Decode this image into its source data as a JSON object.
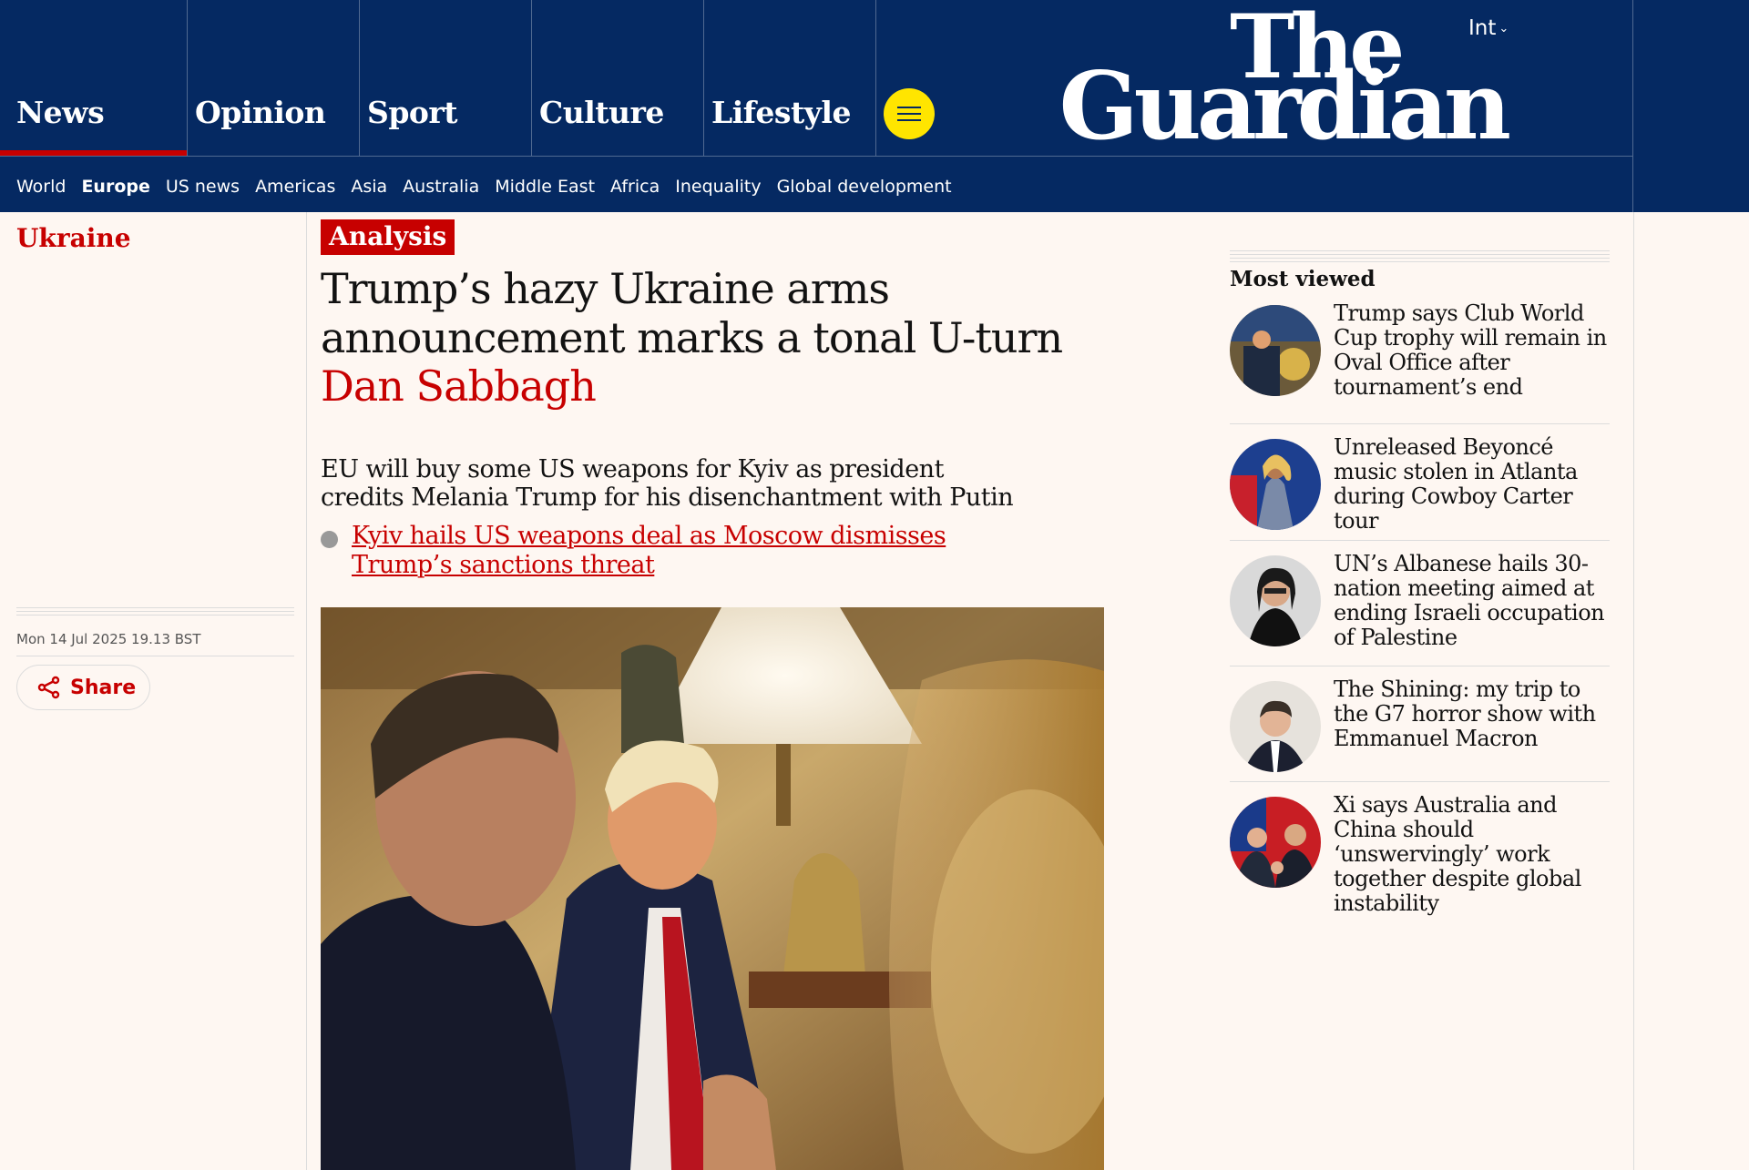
{
  "header": {
    "pillars": [
      "News",
      "Opinion",
      "Sport",
      "Culture",
      "Lifestyle"
    ],
    "edition": "Int",
    "logo_line1": "The",
    "logo_line2": "Guardian",
    "subnav": [
      "World",
      "Europe",
      "US news",
      "Americas",
      "Asia",
      "Australia",
      "Middle East",
      "Africa",
      "Inequality",
      "Global development"
    ]
  },
  "article": {
    "section": "Ukraine",
    "kicker": "Analysis",
    "headline": "Trump’s hazy Ukraine arms announcement marks a tonal U-turn",
    "byline": "Dan Sabbagh",
    "standfirst": "EU will buy some US weapons for Kyiv as president credits Melania Trump for his disenchantment with Putin",
    "related_link": "Kyiv hails US weapons deal as Moscow dismisses Trump’s sanctions threat",
    "dateline": "Mon 14 Jul 2025 19.13 BST",
    "share_label": "Share"
  },
  "most_viewed": {
    "title": "Most viewed",
    "items": [
      "Trump says Club World Cup trophy will remain in Oval Office after tournament’s end",
      "Unreleased Beyoncé music stolen in Atlanta during Cowboy Carter tour",
      "UN’s Albanese hails 30-nation meeting aimed at ending Israeli occupation of Palestine",
      "The Shining: my trip to the G7 horror show with Emmanuel Macron",
      "Xi says Australia and China should ‘unswervingly’ work together despite global instability"
    ]
  },
  "colors": {
    "brand_navy": "#052962",
    "accent_red": "#c70000",
    "menu_yellow": "#ffe500",
    "page_bg": "#fef7f2"
  }
}
